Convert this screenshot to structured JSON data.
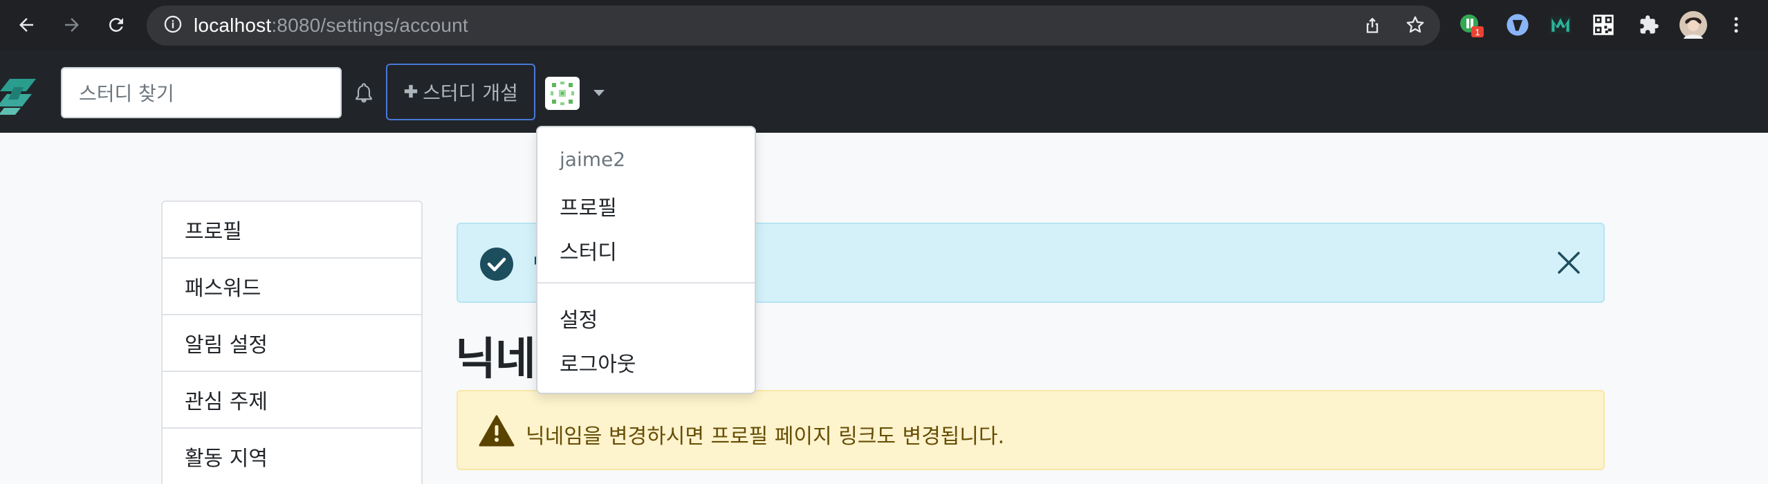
{
  "browser": {
    "url_host": "localhost",
    "url_path": ":8080/settings/account",
    "extension_badge": "1"
  },
  "navbar": {
    "search_placeholder": "스터디 찾기",
    "create_study_label": "스터디 개설"
  },
  "dropdown": {
    "username": "jaime2",
    "items": [
      "프로필",
      "스터디",
      "설정",
      "로그아웃"
    ]
  },
  "sidebar": {
    "items": [
      "프로필",
      "패스워드",
      "알림 설정",
      "관심 주제",
      "활동 지역"
    ]
  },
  "main": {
    "success_alert_text": "닉",
    "heading": "닉네",
    "warning_text": "닉네임을 변경하시면 프로필 페이지 링크도 변경됩니다."
  },
  "colors": {
    "navbar_bg": "#212529",
    "info_alert_bg": "#d4f1f9",
    "warning_alert_bg": "#fdf3cd",
    "active_sidebar_border": "#dc3545"
  }
}
